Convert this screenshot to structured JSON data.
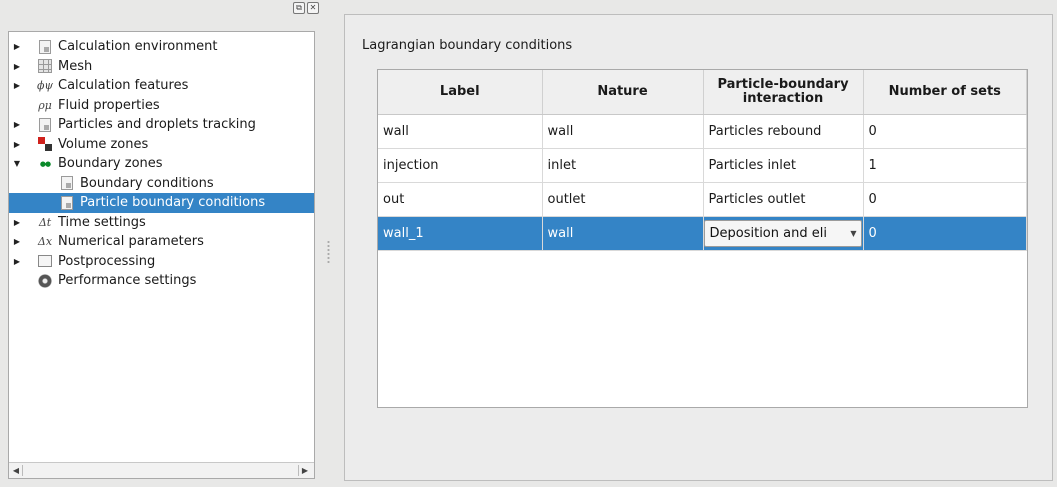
{
  "tree": {
    "items": [
      {
        "label": "Calculation environment",
        "expander": "collapsed",
        "icon": "document-icon",
        "level": 0
      },
      {
        "label": "Mesh",
        "expander": "collapsed",
        "icon": "grid-icon",
        "level": 0
      },
      {
        "label": "Calculation features",
        "expander": "collapsed",
        "icon": "phi-psi-icon",
        "level": 0,
        "glyph": "ϕψ"
      },
      {
        "label": "Fluid properties",
        "expander": "none",
        "icon": "rho-mu-icon",
        "level": 0,
        "glyph": "ρμ"
      },
      {
        "label": "Particles and droplets tracking",
        "expander": "collapsed",
        "icon": "document-icon",
        "level": 0
      },
      {
        "label": "Volume zones",
        "expander": "collapsed",
        "icon": "volume-icon",
        "level": 0
      },
      {
        "label": "Boundary zones",
        "expander": "expanded",
        "icon": "boundary-icon",
        "level": 0,
        "glyph": "↔"
      },
      {
        "label": "Boundary conditions",
        "expander": "none",
        "icon": "document-icon",
        "level": 1
      },
      {
        "label": "Particle boundary conditions",
        "expander": "none",
        "icon": "document-icon",
        "level": 1,
        "selected": true
      },
      {
        "label": "Time settings",
        "expander": "collapsed",
        "icon": "delta-t-icon",
        "level": 0,
        "glyph": "Δt"
      },
      {
        "label": "Numerical parameters",
        "expander": "collapsed",
        "icon": "delta-x-icon",
        "level": 0,
        "glyph": "Δx"
      },
      {
        "label": "Postprocessing",
        "expander": "collapsed",
        "icon": "chart-icon",
        "level": 0
      },
      {
        "label": "Performance settings",
        "expander": "none",
        "icon": "gear-icon",
        "level": 0
      }
    ]
  },
  "dock": {
    "float_glyph": "⧉",
    "close_glyph": "✕"
  },
  "panel": {
    "title": "Lagrangian boundary conditions",
    "columns": [
      "Label",
      "Nature",
      "Particle-boundary\ninteraction",
      "Number of sets"
    ],
    "rows": [
      {
        "label": "wall",
        "nature": "wall",
        "interaction": "Particles rebound",
        "sets": "0"
      },
      {
        "label": "injection",
        "nature": "inlet",
        "interaction": "Particles inlet",
        "sets": "1"
      },
      {
        "label": "out",
        "nature": "outlet",
        "interaction": "Particles outlet",
        "sets": "0"
      },
      {
        "label": "wall_1",
        "nature": "wall",
        "interaction": "Deposition and eli",
        "sets": "0",
        "selected": true,
        "editing": true
      }
    ]
  },
  "colors": {
    "selection": "#3484c6",
    "background": "#e8e8e7"
  }
}
